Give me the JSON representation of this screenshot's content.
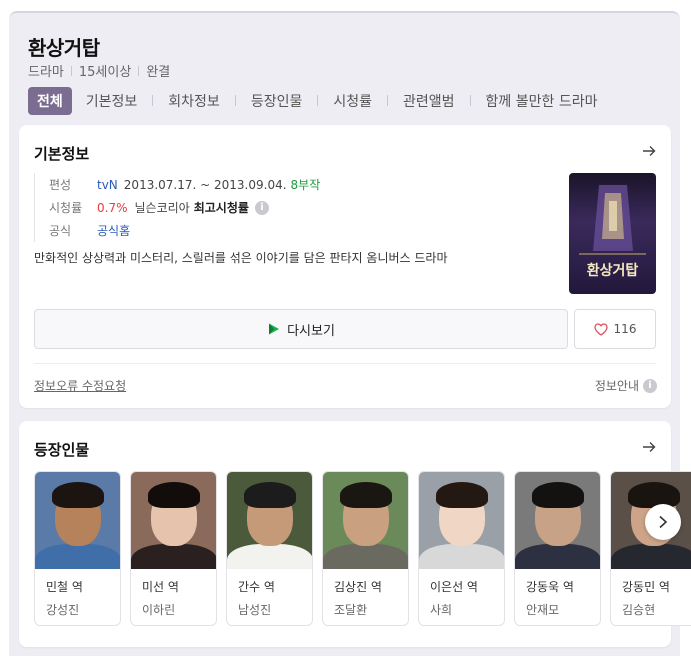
{
  "header": {
    "title": "환상거탑",
    "meta": [
      "드라마",
      "15세이상",
      "완결"
    ]
  },
  "tabs": [
    "전체",
    "기본정보",
    "회차정보",
    "등장인물",
    "시청률",
    "관련앨범",
    "함께 볼만한 드라마"
  ],
  "basic_info": {
    "section_title": "기본정보",
    "broadcast": {
      "label": "편성",
      "channel": "tvN",
      "dates": "2013.07.17. ~ 2013.09.04.",
      "episodes": "8부작"
    },
    "rating": {
      "label": "시청률",
      "value": "0.7%",
      "source": "닐슨코리아",
      "note": "최고시청률"
    },
    "official": {
      "label": "공식",
      "link": "공식홈"
    },
    "description": "만화적인 상상력과 미스터리, 스릴러를 섞은 이야기를 담은 판타지 옴니버스 드라마",
    "poster_title": "환상거탑",
    "replay_label": "다시보기",
    "like_count": "116",
    "report_link": "정보오류 수정요청",
    "info_guide": "정보안내",
    "info_glyph": "i"
  },
  "cast_section": {
    "section_title": "등장인물",
    "cast": [
      {
        "role": "민철 역",
        "actor": "강성진",
        "bg": "#5a7aa8",
        "skin": "#b5825c",
        "hair": "#1b1410",
        "cloth": "#3f6ea8"
      },
      {
        "role": "미선 역",
        "actor": "이하린",
        "bg": "#8a6a5a",
        "skin": "#e6c3ad",
        "hair": "#120c0a",
        "cloth": "#2a2020"
      },
      {
        "role": "간수 역",
        "actor": "남성진",
        "bg": "#4a5a3a",
        "skin": "#c49a78",
        "hair": "#1c1c1c",
        "cloth": "#f2f2ee"
      },
      {
        "role": "김상진 역",
        "actor": "조달환",
        "bg": "#6a8a5a",
        "skin": "#c9a080",
        "hair": "#1a1612",
        "cloth": "#6a6a60"
      },
      {
        "role": "이은선 역",
        "actor": "사희",
        "bg": "#9aa0a8",
        "skin": "#f0d6c4",
        "hair": "#241812",
        "cloth": "#d8d8d8"
      },
      {
        "role": "강동욱 역",
        "actor": "안재모",
        "bg": "#7a7a7a",
        "skin": "#c8a286",
        "hair": "#141210",
        "cloth": "#2c3040"
      },
      {
        "role": "강동민 역",
        "actor": "김승현",
        "bg": "#5a5048",
        "skin": "#cda488",
        "hair": "#1a1410",
        "cloth": "#262830"
      }
    ]
  },
  "colors": {
    "accent_tab": "#7b6d91",
    "channel_link": "#2a5bb8",
    "episodes": "#1f9a3f",
    "rating": "#e53b3b",
    "heart": "#e05060",
    "play_green": "#18b04a"
  }
}
